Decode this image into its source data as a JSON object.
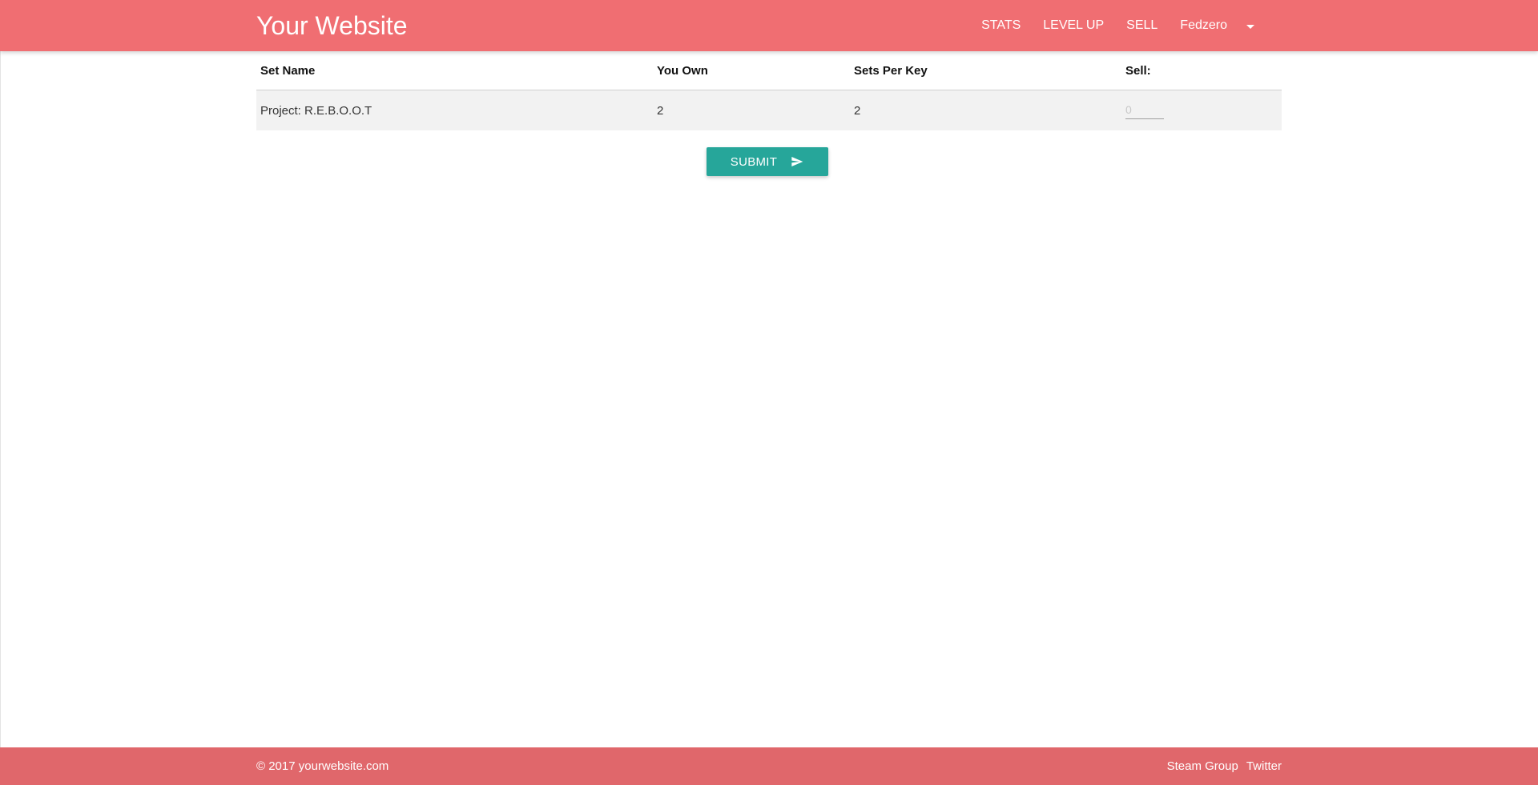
{
  "navbar": {
    "brand": "Your Website",
    "links": [
      "STATS",
      "LEVEL UP",
      "SELL"
    ],
    "user": "Fedzero",
    "user_icon": "caret-down-icon"
  },
  "table": {
    "headers": [
      "Set Name",
      "You Own",
      "Sets Per Key",
      "Sell:"
    ],
    "rows": [
      {
        "set_name": "Project: R.E.B.O.O.T",
        "you_own": "2",
        "sets_per_key": "2",
        "sell_placeholder": "0",
        "sell_value": ""
      }
    ]
  },
  "submit": {
    "label": "SUBMIT",
    "icon": "send-icon"
  },
  "footer": {
    "copyright": "© 2017 yourwebsite.com",
    "links": [
      "Steam Group",
      "Twitter"
    ]
  },
  "colors": {
    "navbar": "#f06e72",
    "footer": "#e0676b",
    "button": "#26a69a",
    "row": "#f2f2f2"
  }
}
